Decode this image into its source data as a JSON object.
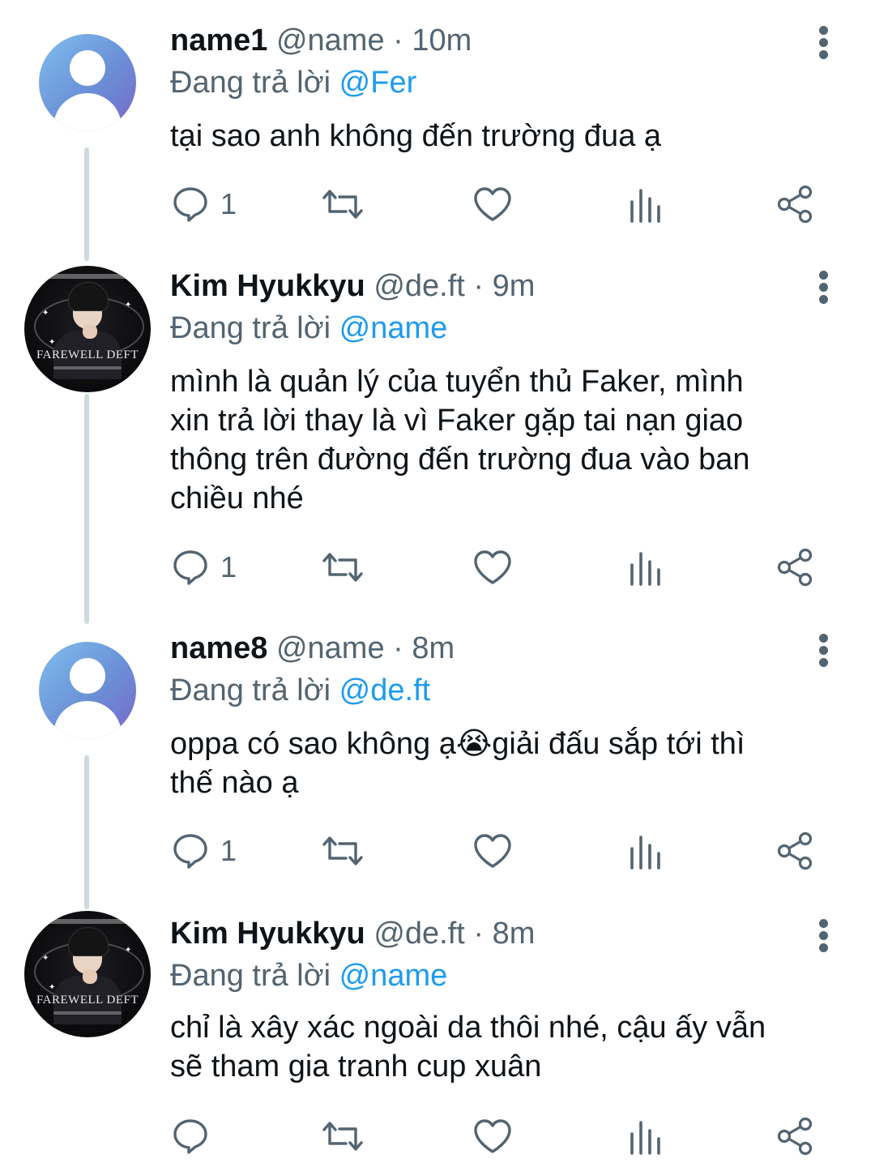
{
  "tweets": [
    {
      "display_name": "name1",
      "meta": "@name · 10m",
      "reply_prefix": "Đang trả lời ",
      "reply_mention": "@Fer",
      "text": "tại sao anh không đến trường đua ạ",
      "reply_count": "1",
      "avatar": "default-user-avatar"
    },
    {
      "display_name": "Kim Hyukkyu",
      "meta": "@de.ft · 9m",
      "reply_prefix": "Đang trả lời ",
      "reply_mention": "@name",
      "text": "mình là quản lý của tuyển thủ Faker, mình\nxin trả lời thay là vì Faker gặp tai nạn giao\nthông trên đường đến trường đua vào ban\nchiều nhé",
      "reply_count": "1",
      "avatar": "photo-avatar",
      "avatar_text": "FAREWELL DEFT"
    },
    {
      "display_name": "name8",
      "meta": "@name · 8m",
      "reply_prefix": "Đang trả lời ",
      "reply_mention": "@de.ft",
      "text": "oppa có sao không ạ😭giải đấu sắp tới thì\nthế nào ạ",
      "reply_count": "1",
      "avatar": "default-user-avatar"
    },
    {
      "display_name": "Kim Hyukkyu",
      "meta": "@de.ft · 8m",
      "reply_prefix": "Đang trả lời ",
      "reply_mention": "@name",
      "text": "chỉ là xây xác ngoài da thôi nhé, cậu ấy vẫn\nsẽ tham gia tranh cup xuân",
      "reply_count": "",
      "avatar": "photo-avatar",
      "avatar_text": "FAREWELL DEFT"
    }
  ],
  "icons": {
    "reply": "comment-bubble-icon",
    "retweet": "retweet-icon",
    "like": "heart-icon",
    "views": "analytics-bars-icon",
    "share": "share-icon",
    "more": "vertical-ellipsis-icon"
  },
  "colors": {
    "text": "#0f1419",
    "secondary": "#536471",
    "mention": "#1d9bf0",
    "thread_line": "#cfd9de"
  }
}
